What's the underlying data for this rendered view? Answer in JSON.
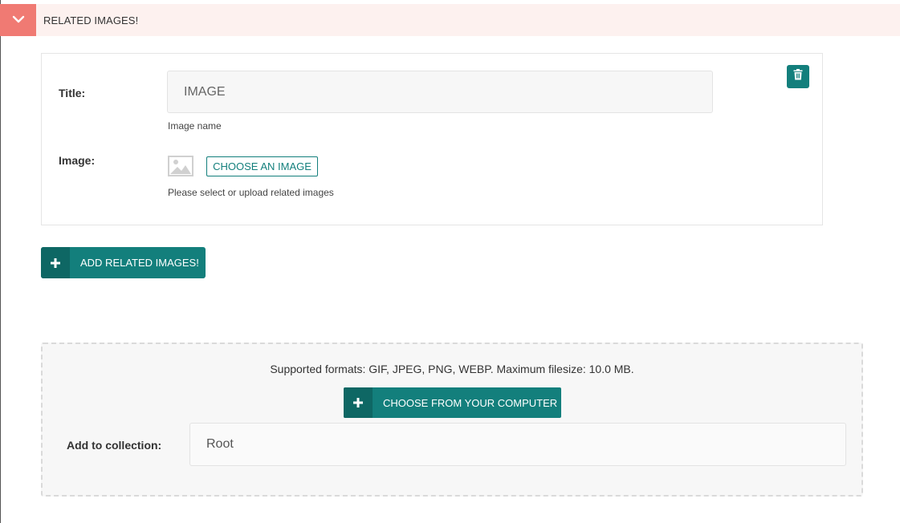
{
  "header": {
    "title": "RELATED IMAGES!",
    "collapse_icon": "chevron-down-icon"
  },
  "related_image": {
    "title_label": "Title:",
    "title_value": "IMAGE",
    "title_help": "Image name",
    "image_label": "Image:",
    "choose_image_label": "CHOOSE AN IMAGE",
    "image_help": "Please select or upload related images",
    "delete_icon": "trash-icon"
  },
  "add_button": {
    "label": "ADD RELATED IMAGES!",
    "icon": "plus-icon"
  },
  "uploader": {
    "formats_text": "Supported formats: GIF, JPEG, PNG, WEBP. Maximum filesize: 10.0 MB.",
    "upload_button_label": "CHOOSE FROM YOUR COMPUTER",
    "collection_label": "Add to collection:",
    "collection_value": "Root"
  },
  "colors": {
    "accent": "#137f7c",
    "accent_dark": "#0e6764",
    "header_bg": "#fdf1ef",
    "header_button": "#f07a73"
  }
}
